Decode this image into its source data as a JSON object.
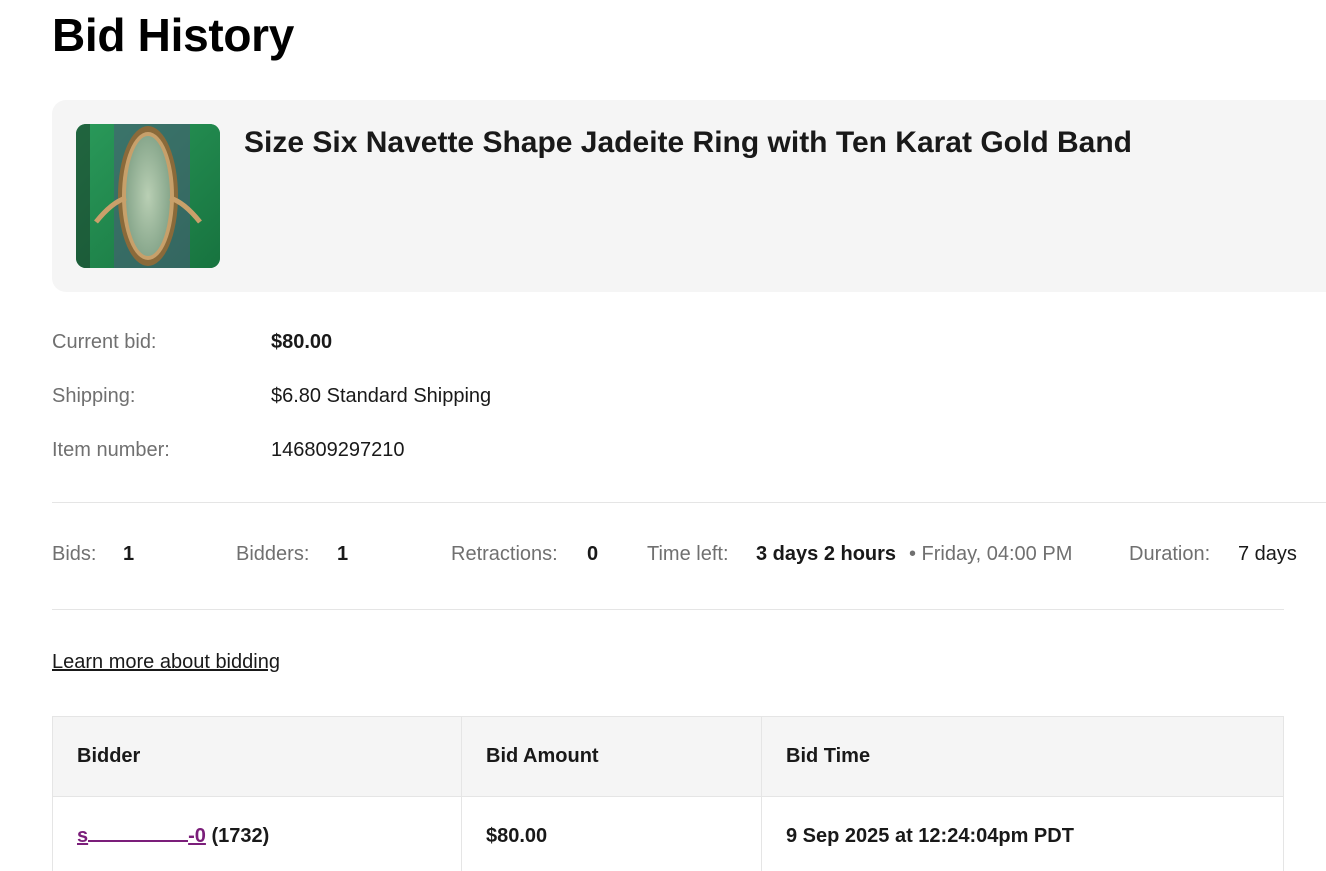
{
  "page": {
    "title": "Bid History"
  },
  "item": {
    "title": "Size Six Navette Shape Jadeite Ring with Ten Karat Gold Band",
    "image_alt": "ring-photo"
  },
  "info": {
    "current_bid_label": "Current bid:",
    "current_bid_value": "$80.00",
    "shipping_label": "Shipping:",
    "shipping_value": "$6.80 Standard Shipping",
    "item_number_label": "Item number:",
    "item_number_value": "146809297210"
  },
  "stats": {
    "bids_label": "Bids:",
    "bids_value": "1",
    "bidders_label": "Bidders:",
    "bidders_value": "1",
    "retractions_label": "Retractions:",
    "retractions_value": "0",
    "time_left_label": "Time left:",
    "time_left_value": "3 days 2 hours",
    "time_left_end": "• Friday, 04:00 PM",
    "duration_label": "Duration:",
    "duration_value": "7 days"
  },
  "learn_link": "Learn more about bidding",
  "table": {
    "headers": [
      "Bidder",
      "Bid Amount",
      "Bid Time"
    ],
    "rows": [
      {
        "bidder_start": "s",
        "bidder_end": "-0",
        "feedback": "(1732)",
        "amount": "$80.00",
        "time": "9 Sep 2025 at 12:24:04pm PDT"
      }
    ]
  },
  "colors": {
    "link_purple": "#7b1e7a",
    "card_bg": "#f5f5f5",
    "label_gray": "#707070"
  }
}
